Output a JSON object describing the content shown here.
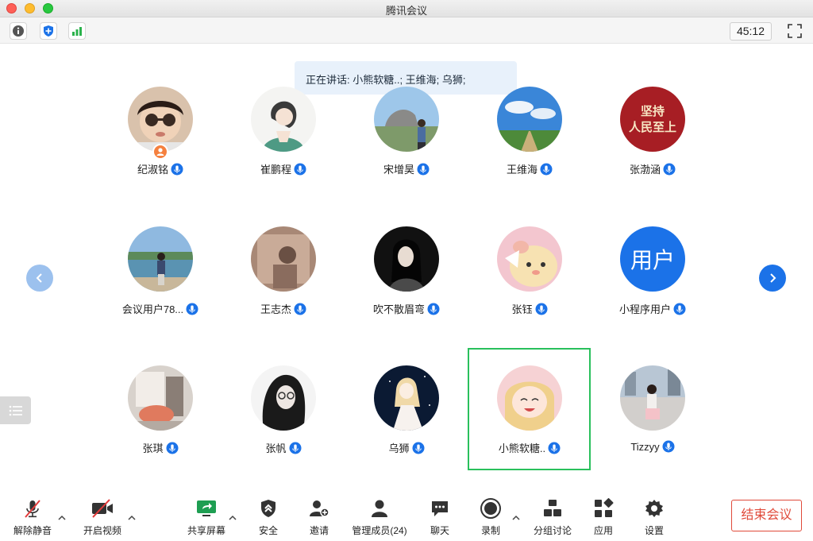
{
  "window": {
    "title": "腾讯会议"
  },
  "topbar": {
    "timer": "45:12"
  },
  "speaking_banner": "正在讲话: 小熊软糖..; 王维海; 乌狮;",
  "participants": [
    {
      "name": "纪淑铭"
    },
    {
      "name": "崔鹏程"
    },
    {
      "name": "宋增昊"
    },
    {
      "name": "王维海"
    },
    {
      "name": "张渤涵",
      "avatar_text": "坚持\n人民至上"
    },
    {
      "name": "会议用户78..."
    },
    {
      "name": "王志杰"
    },
    {
      "name": "吹不散眉弯"
    },
    {
      "name": "张钰"
    },
    {
      "name": "小程序用户",
      "avatar_text": "用户"
    },
    {
      "name": "张琪"
    },
    {
      "name": "张帆"
    },
    {
      "name": "乌狮"
    },
    {
      "name": "小熊软糖.."
    },
    {
      "name": "Tizzyy"
    }
  ],
  "toolbar": {
    "unmute": "解除静音",
    "start_video": "开启视频",
    "share_screen": "共享屏幕",
    "security": "安全",
    "invite": "邀请",
    "manage_members": "管理成员(24)",
    "chat": "聊天",
    "record": "录制",
    "breakout": "分组讨论",
    "apps": "应用",
    "settings": "设置",
    "end_meeting": "结束会议"
  },
  "colors": {
    "accent": "#1b72e8",
    "active_speaker": "#29c05c",
    "end": "#e04a3a"
  }
}
